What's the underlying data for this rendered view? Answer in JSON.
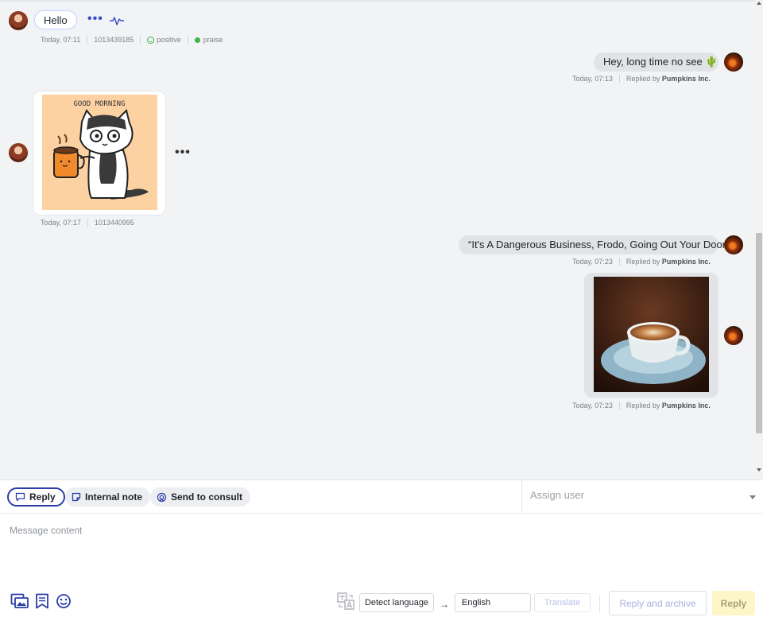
{
  "chat": {
    "messages": [
      {
        "direction": "in",
        "text": "Hello",
        "time": "Today, 07:11",
        "id": "1013439185",
        "sentiment": "positive",
        "tag": "praise"
      },
      {
        "direction": "out",
        "text": "Hey, long time no see 🌵",
        "time": "Today, 07:13",
        "replied_by_prefix": "Replied by",
        "replied_by_name": "Pumpkins Inc."
      },
      {
        "direction": "in",
        "image": "good-morning-cat-sticker",
        "image_caption": "GOOD MORNING",
        "time": "Today, 07:17",
        "id": "1013440995"
      },
      {
        "direction": "out",
        "text": "“It's A Dangerous Business, Frodo, Going Out Your Door.”",
        "time": "Today, 07:23",
        "replied_by_prefix": "Replied by",
        "replied_by_name": "Pumpkins Inc."
      },
      {
        "direction": "out",
        "image": "coffee-cup-photo",
        "time": "Today, 07:23",
        "replied_by_prefix": "Replied by",
        "replied_by_name": "Pumpkins Inc."
      }
    ]
  },
  "composer": {
    "tabs": [
      {
        "label": "Reply",
        "icon": "chat-bubble-icon",
        "active": true
      },
      {
        "label": "Internal note",
        "icon": "note-icon",
        "active": false
      },
      {
        "label": "Send to consult",
        "icon": "consult-icon",
        "active": false
      }
    ],
    "assign_placeholder": "Assign user",
    "message_placeholder": "Message content",
    "detect_language": "Detect language",
    "target_language": "English",
    "translate": "Translate",
    "reply_and_archive": "Reply and archive",
    "reply": "Reply"
  },
  "colors": {
    "accent": "#2c3ea8",
    "positive": "#3bb54a",
    "reply_button_bg": "#fdf6c9",
    "chat_bg": "#f2f3f5"
  }
}
